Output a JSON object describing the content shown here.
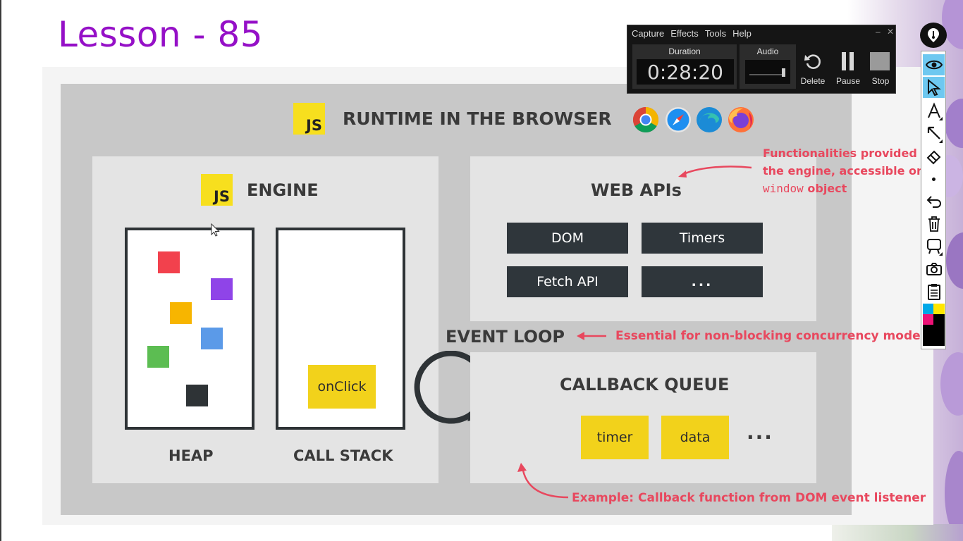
{
  "lesson": {
    "title": "Lesson - 85"
  },
  "slide": {
    "runtime_title": "RUNTIME IN THE BROWSER",
    "js_logo_text": "JS",
    "browsers": [
      "chrome-icon",
      "safari-icon",
      "edge-icon",
      "firefox-icon"
    ],
    "engine": {
      "title": "ENGINE",
      "heap_label": "HEAP",
      "call_stack_label": "CALL STACK",
      "stack_item": "onClick",
      "heap_colors": [
        "#f2414d",
        "#8f44e8",
        "#f7b500",
        "#5b9ae8",
        "#5cbd52",
        "#2e3336"
      ]
    },
    "web_apis": {
      "title": "WEB APIs",
      "items": [
        "DOM",
        "Timers",
        "Fetch API",
        "..."
      ]
    },
    "event_loop": {
      "title": "EVENT LOOP"
    },
    "callback_queue": {
      "title": "CALLBACK QUEUE",
      "items": [
        "timer",
        "data"
      ],
      "more": "..."
    },
    "annotations": {
      "web_api_note_line1": "Functionalities provided to",
      "web_api_note_line2": "the engine, accessible on",
      "web_api_note_code": "window",
      "web_api_note_line3": " object",
      "event_loop_note": "Essential for non-blocking concurrency model",
      "callback_note": "Example: Callback function from DOM event listener"
    },
    "accent_color": "#e8485e"
  },
  "capture_toolbar": {
    "menu": [
      "Capture",
      "Effects",
      "Tools",
      "Help"
    ],
    "duration_label": "Duration",
    "duration_value": "0:28:20",
    "audio_label": "Audio",
    "delete_label": "Delete",
    "pause_label": "Pause",
    "stop_label": "Stop"
  },
  "tool_palette": {
    "tools": [
      "eye-icon",
      "pointer-icon",
      "text-icon",
      "arrow-icon",
      "eraser-icon",
      "dot-icon",
      "undo-icon",
      "trash-icon",
      "easel-icon",
      "camera-icon",
      "clipboard-icon",
      "color-picker"
    ],
    "active_tools": [
      "eye-icon",
      "pointer-icon"
    ]
  }
}
